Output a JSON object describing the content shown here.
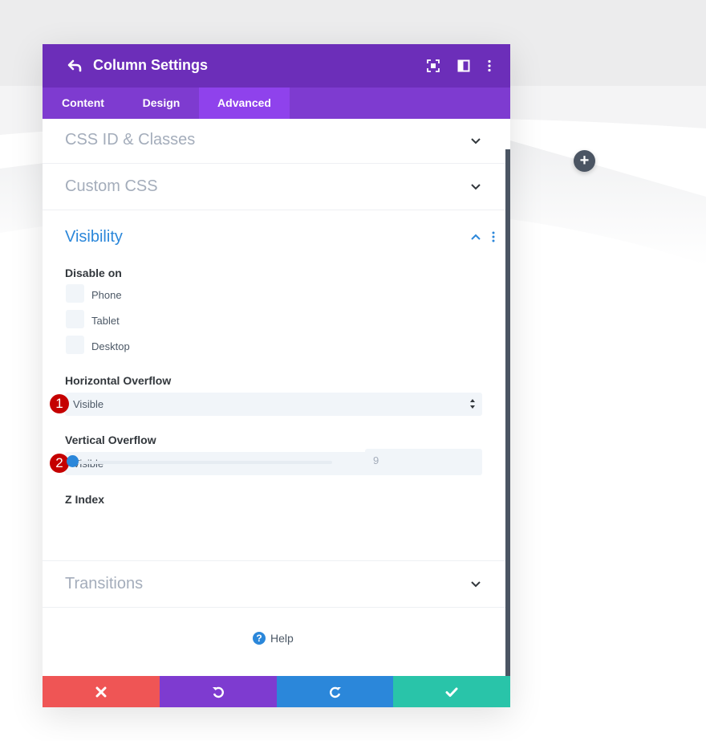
{
  "colors": {
    "header": "#6c2eb9",
    "tabs": "#7e3bd0",
    "tab_active": "#8f42ec",
    "accent_blue": "#2b87da",
    "cancel": "#ef5555",
    "undo": "#7e3bd0",
    "redo": "#2b87da",
    "save": "#29c4a9",
    "badge": "#c50000"
  },
  "header": {
    "title": "Column Settings",
    "icons": [
      "back-arrow-icon",
      "focus-mode-icon",
      "split-view-icon",
      "more-options-icon"
    ]
  },
  "tabs": [
    {
      "label": "Content",
      "active": false
    },
    {
      "label": "Design",
      "active": false
    },
    {
      "label": "Advanced",
      "active": true
    }
  ],
  "sections": {
    "css_id": "CSS ID & Classes",
    "custom_css": "Custom CSS",
    "visibility": "Visibility",
    "transitions": "Transitions"
  },
  "visibility": {
    "disable_on_label": "Disable on",
    "options": [
      "Phone",
      "Tablet",
      "Desktop"
    ],
    "horizontal_overflow": {
      "label": "Horizontal Overflow",
      "value": "Visible",
      "badge": "1"
    },
    "vertical_overflow": {
      "label": "Vertical Overflow",
      "value": "Visible",
      "badge": "2"
    },
    "z_index": {
      "label": "Z Index",
      "value": "9"
    }
  },
  "help": {
    "label": "Help"
  },
  "footer": {
    "buttons": [
      "cancel",
      "undo",
      "redo",
      "save"
    ]
  }
}
